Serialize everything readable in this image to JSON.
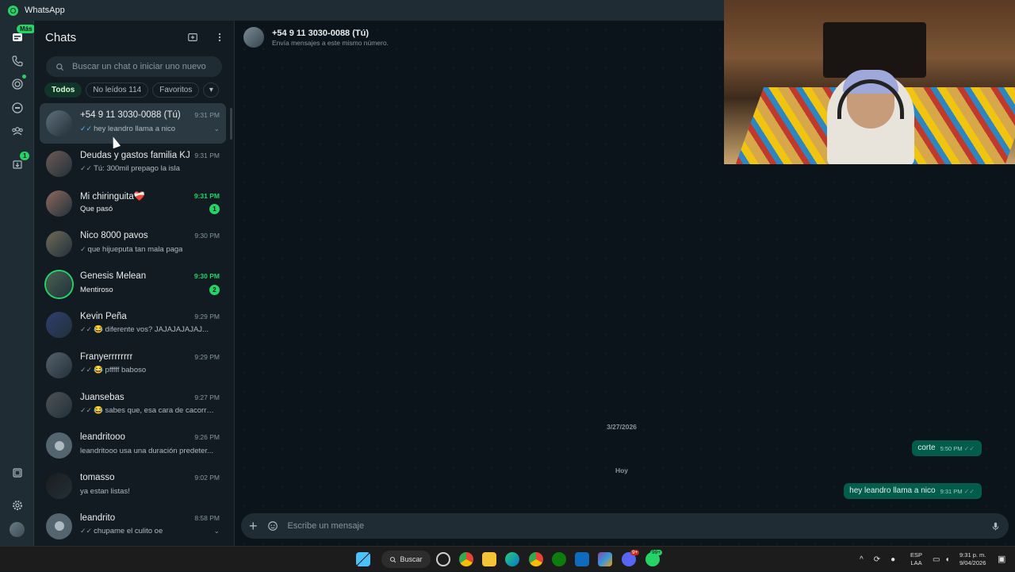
{
  "window": {
    "title": "WhatsApp"
  },
  "rail": {
    "badge_mas": "Más",
    "updates_badge": "1"
  },
  "list": {
    "title": "Chats",
    "search_placeholder": "Buscar un chat o iniciar uno nuevo",
    "filters": {
      "all": "Todos",
      "unread": "No leídos 114",
      "favorites": "Favoritos"
    }
  },
  "chats": [
    {
      "name": "+54 9 11 3030-0088 (Tú)",
      "time": "9:31 PM",
      "message": "hey leandro llama a nico",
      "tick": "✓✓",
      "tick_color": "blue"
    },
    {
      "name": "Deudas  y  gastos familia KJ",
      "time": "9:31 PM",
      "message": "Tú: 300mil prepago la isla",
      "tick": "✓✓",
      "tick_color": "grey"
    },
    {
      "name": "Mi chiringuita❤️‍🩹",
      "time": "9:31 PM",
      "message": "Que pasó",
      "unread": "1"
    },
    {
      "name": "Nico 8000 pavos",
      "time": "9:30 PM",
      "message": "que hijueputa tan mala paga",
      "tick": "✓",
      "tick_color": "grey"
    },
    {
      "name": "Genesis Melean",
      "time": "9:30 PM",
      "message": "Mentiroso",
      "unread": "2"
    },
    {
      "name": "Kevin Peña",
      "time": "9:29 PM",
      "message": "😂 diferente vos? JAJAJAJAJAJ...",
      "tick": "✓✓",
      "tick_color": "grey"
    },
    {
      "name": "Franyerrrrrrrr",
      "time": "9:29 PM",
      "message": "😂 pfffff baboso",
      "tick": "✓✓",
      "tick_color": "grey"
    },
    {
      "name": "Juansebas",
      "time": "9:27 PM",
      "message": "😂 sabes que, esa cara de cacorro ...",
      "tick": "✓✓",
      "tick_color": "grey"
    },
    {
      "name": "leandritooo",
      "time": "9:26 PM",
      "message": "leandritooo usa una duración predeter..."
    },
    {
      "name": "tomasso",
      "time": "9:02 PM",
      "message": "ya estan listas!"
    },
    {
      "name": "leandrito",
      "time": "8:58 PM",
      "message": "chupame el culito oe",
      "tick": "✓✓",
      "tick_color": "grey"
    }
  ],
  "conversation": {
    "title": "+54 9 11 3030-0088 (Tú)",
    "subtitle": "Envía mensajes a este mismo número.",
    "date_1": "3/27/2026",
    "date_2": "Hoy",
    "messages": [
      {
        "text": "corte",
        "time": "5:50 PM",
        "tick": "✓✓"
      },
      {
        "text": "hey leandro llama a nico",
        "time": "9:31 PM",
        "tick": "✓✓"
      }
    ],
    "composer_placeholder": "Escribe un mensaje"
  },
  "taskbar": {
    "search_label": "Buscar",
    "lang_1": "ESP",
    "lang_2": "LAA",
    "time": "9:31 p. m.",
    "date": "9/04/2026",
    "whatsapp_badge": "99+",
    "discord_badge": "9+"
  }
}
